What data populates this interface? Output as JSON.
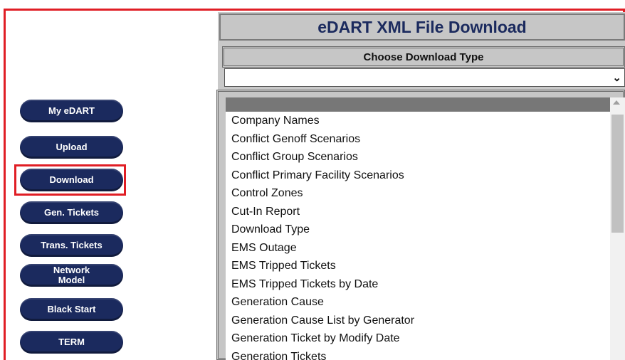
{
  "nav": {
    "items": [
      {
        "label": "My eDART"
      },
      {
        "label": "Upload"
      },
      {
        "label": "Download"
      },
      {
        "label": "Gen. Tickets"
      },
      {
        "label": "Trans. Tickets"
      },
      {
        "label": "Network Model"
      },
      {
        "label": "Black Start"
      },
      {
        "label": "TERM"
      }
    ],
    "selected": "Download"
  },
  "main": {
    "title": "eDART XML File Download",
    "choose_label": "Choose Download Type",
    "select_value": "",
    "chevron_icon": "chevron-down-icon",
    "list": {
      "selected_item": "",
      "items": [
        "Company Names",
        "Conflict Genoff Scenarios",
        "Conflict Group Scenarios",
        "Conflict Primary Facility Scenarios",
        "Control Zones",
        "Cut-In Report",
        "Download Type",
        "EMS Outage",
        "EMS Tripped Tickets",
        "EMS Tripped Tickets by Date",
        "Generation Cause",
        "Generation Cause List by Generator",
        "Generation Ticket by Modify Date",
        "Generation Tickets"
      ]
    }
  },
  "colors": {
    "accent": "#1b2a5e",
    "highlight": "#e01e25",
    "panel": "#c6c6c6"
  }
}
